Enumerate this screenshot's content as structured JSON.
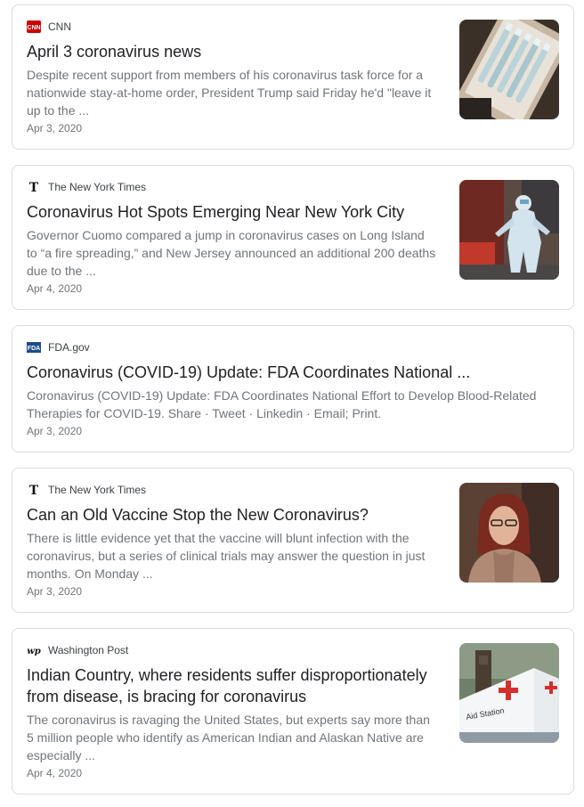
{
  "articles": [
    {
      "source": "CNN",
      "logo_icon": "cnn-logo-icon",
      "headline": "April 3 coronavirus news",
      "snippet": "Despite recent support from members of his coronavirus task force for a nationwide stay-at-home order, President Trump said Friday he'd \"leave it up to the ...",
      "date": "Apr 3, 2020",
      "thumbnail": "test-tube-rack-image"
    },
    {
      "source": "The New York Times",
      "logo_icon": "nyt-logo-icon",
      "headline": "Coronavirus Hot Spots Emerging Near New York City",
      "snippet": "Governor Cuomo compared a jump in coronavirus cases on Long Island to “a fire spreading,” and New Jersey announced an additional 200 deaths due to the ...",
      "date": "Apr 4, 2020",
      "thumbnail": "hazmat-worker-image"
    },
    {
      "source": "FDA.gov",
      "logo_icon": "fda-logo-icon",
      "headline": "Coronavirus (COVID-19) Update: FDA Coordinates National ...",
      "snippet": "Coronavirus (COVID-19) Update: FDA Coordinates National Effort to Develop Blood-Related Therapies for COVID-19. Share · Tweet · Linkedin · Email; Print.",
      "date": "Apr 3, 2020"
    },
    {
      "source": "The New York Times",
      "logo_icon": "nyt-logo-icon",
      "headline": "Can an Old Vaccine Stop the New Coronavirus?",
      "snippet": "There is little evidence yet that the vaccine will blunt infection with the coronavirus, but a series of clinical trials may answer the question in just months. On Monday ...",
      "date": "Apr 3, 2020",
      "thumbnail": "woman-portrait-image"
    },
    {
      "source": "Washington Post",
      "logo_icon": "wapo-logo-icon",
      "headline": "Indian Country, where residents suffer disproportionately from disease, is bracing for coronavirus",
      "snippet": "The coronavirus is ravaging the United States, but experts say more than 5 million people who identify as American Indian and Alaskan Native are especially ...",
      "date": "Apr 4, 2020",
      "thumbnail": "aid-station-tent-image",
      "thumbnail_text": "Aid Station"
    }
  ],
  "colors": {
    "cnn_red": "#cc0000",
    "fda_blue": "#1c4b8c",
    "headline": "#202124",
    "snippet": "#70757a",
    "border": "#dadce0"
  }
}
